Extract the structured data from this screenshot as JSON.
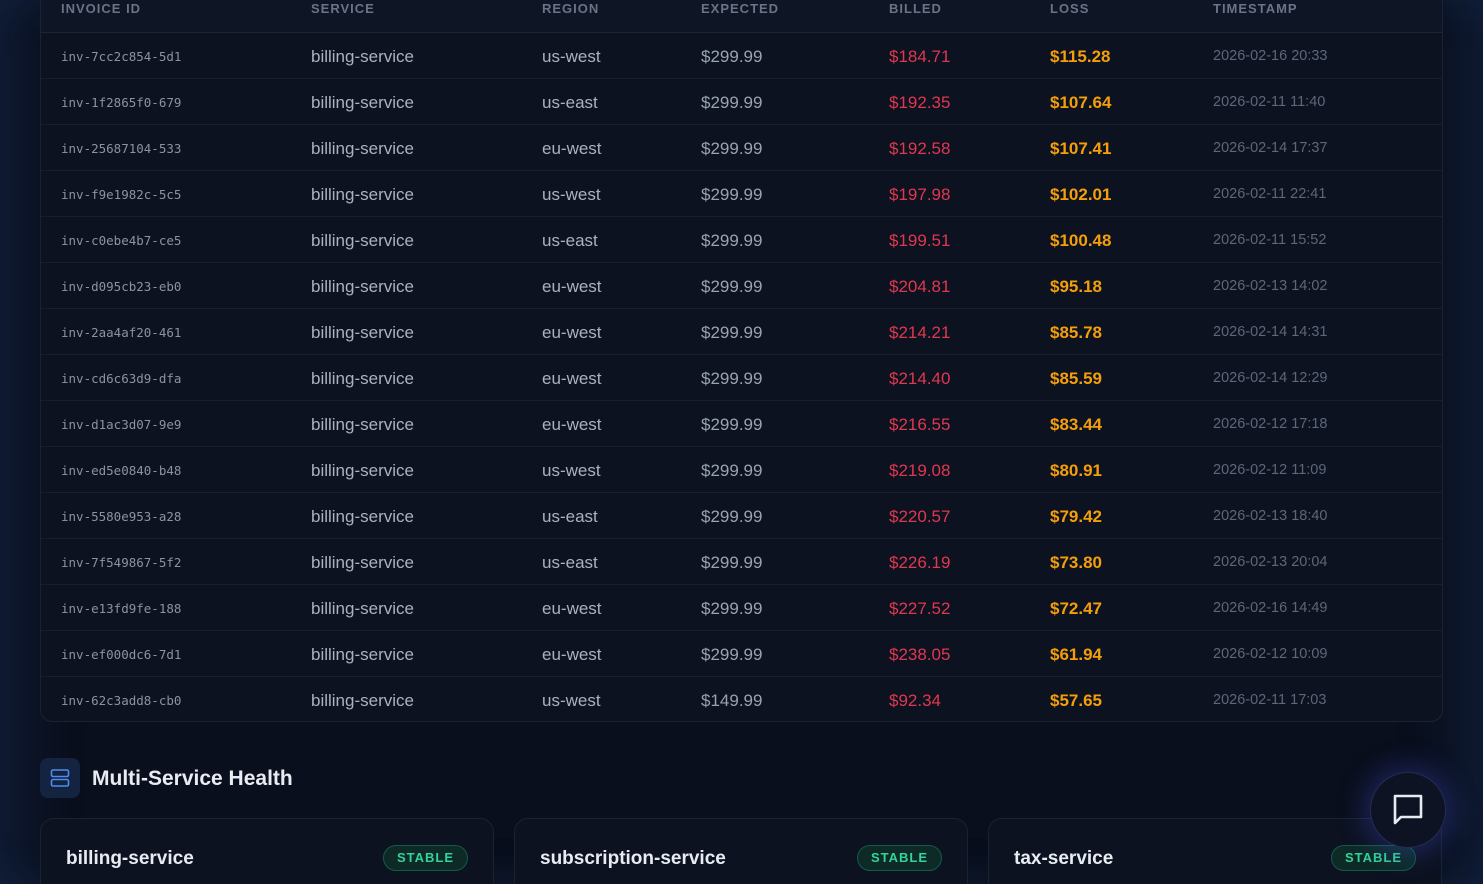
{
  "table": {
    "headers": {
      "invoice_id": "INVOICE ID",
      "service": "SERVICE",
      "region": "REGION",
      "expected": "EXPECTED",
      "billed": "BILLED",
      "loss": "LOSS",
      "timestamp": "TIMESTAMP"
    },
    "rows": [
      {
        "invoice_id": "inv-7cc2c854-5d1",
        "service": "billing-service",
        "region": "us-west",
        "expected": "$299.99",
        "billed": "$184.71",
        "loss": "$115.28",
        "timestamp": "2026-02-16 20:33"
      },
      {
        "invoice_id": "inv-1f2865f0-679",
        "service": "billing-service",
        "region": "us-east",
        "expected": "$299.99",
        "billed": "$192.35",
        "loss": "$107.64",
        "timestamp": "2026-02-11 11:40"
      },
      {
        "invoice_id": "inv-25687104-533",
        "service": "billing-service",
        "region": "eu-west",
        "expected": "$299.99",
        "billed": "$192.58",
        "loss": "$107.41",
        "timestamp": "2026-02-14 17:37"
      },
      {
        "invoice_id": "inv-f9e1982c-5c5",
        "service": "billing-service",
        "region": "us-west",
        "expected": "$299.99",
        "billed": "$197.98",
        "loss": "$102.01",
        "timestamp": "2026-02-11 22:41"
      },
      {
        "invoice_id": "inv-c0ebe4b7-ce5",
        "service": "billing-service",
        "region": "us-east",
        "expected": "$299.99",
        "billed": "$199.51",
        "loss": "$100.48",
        "timestamp": "2026-02-11 15:52"
      },
      {
        "invoice_id": "inv-d095cb23-eb0",
        "service": "billing-service",
        "region": "eu-west",
        "expected": "$299.99",
        "billed": "$204.81",
        "loss": "$95.18",
        "timestamp": "2026-02-13 14:02"
      },
      {
        "invoice_id": "inv-2aa4af20-461",
        "service": "billing-service",
        "region": "eu-west",
        "expected": "$299.99",
        "billed": "$214.21",
        "loss": "$85.78",
        "timestamp": "2026-02-14 14:31"
      },
      {
        "invoice_id": "inv-cd6c63d9-dfa",
        "service": "billing-service",
        "region": "eu-west",
        "expected": "$299.99",
        "billed": "$214.40",
        "loss": "$85.59",
        "timestamp": "2026-02-14 12:29"
      },
      {
        "invoice_id": "inv-d1ac3d07-9e9",
        "service": "billing-service",
        "region": "eu-west",
        "expected": "$299.99",
        "billed": "$216.55",
        "loss": "$83.44",
        "timestamp": "2026-02-12 17:18"
      },
      {
        "invoice_id": "inv-ed5e0840-b48",
        "service": "billing-service",
        "region": "us-west",
        "expected": "$299.99",
        "billed": "$219.08",
        "loss": "$80.91",
        "timestamp": "2026-02-12 11:09"
      },
      {
        "invoice_id": "inv-5580e953-a28",
        "service": "billing-service",
        "region": "us-east",
        "expected": "$299.99",
        "billed": "$220.57",
        "loss": "$79.42",
        "timestamp": "2026-02-13 18:40"
      },
      {
        "invoice_id": "inv-7f549867-5f2",
        "service": "billing-service",
        "region": "us-east",
        "expected": "$299.99",
        "billed": "$226.19",
        "loss": "$73.80",
        "timestamp": "2026-02-13 20:04"
      },
      {
        "invoice_id": "inv-e13fd9fe-188",
        "service": "billing-service",
        "region": "eu-west",
        "expected": "$299.99",
        "billed": "$227.52",
        "loss": "$72.47",
        "timestamp": "2026-02-16 14:49"
      },
      {
        "invoice_id": "inv-ef000dc6-7d1",
        "service": "billing-service",
        "region": "eu-west",
        "expected": "$299.99",
        "billed": "$238.05",
        "loss": "$61.94",
        "timestamp": "2026-02-12 10:09"
      },
      {
        "invoice_id": "inv-62c3add8-cb0",
        "service": "billing-service",
        "region": "us-west",
        "expected": "$149.99",
        "billed": "$92.34",
        "loss": "$57.65",
        "timestamp": "2026-02-11 17:03"
      }
    ]
  },
  "health": {
    "icon": "server-stack-icon",
    "title": "Multi-Service Health",
    "services": [
      {
        "name": "billing-service",
        "status": "STABLE"
      },
      {
        "name": "subscription-service",
        "status": "STABLE"
      },
      {
        "name": "tax-service",
        "status": "STABLE"
      }
    ]
  },
  "chat": {
    "icon": "chat-bubble-icon"
  },
  "colors": {
    "billed": "#e0384e",
    "loss": "#f59e0b",
    "stable": "#34d399",
    "accent": "#4f8cf0"
  }
}
